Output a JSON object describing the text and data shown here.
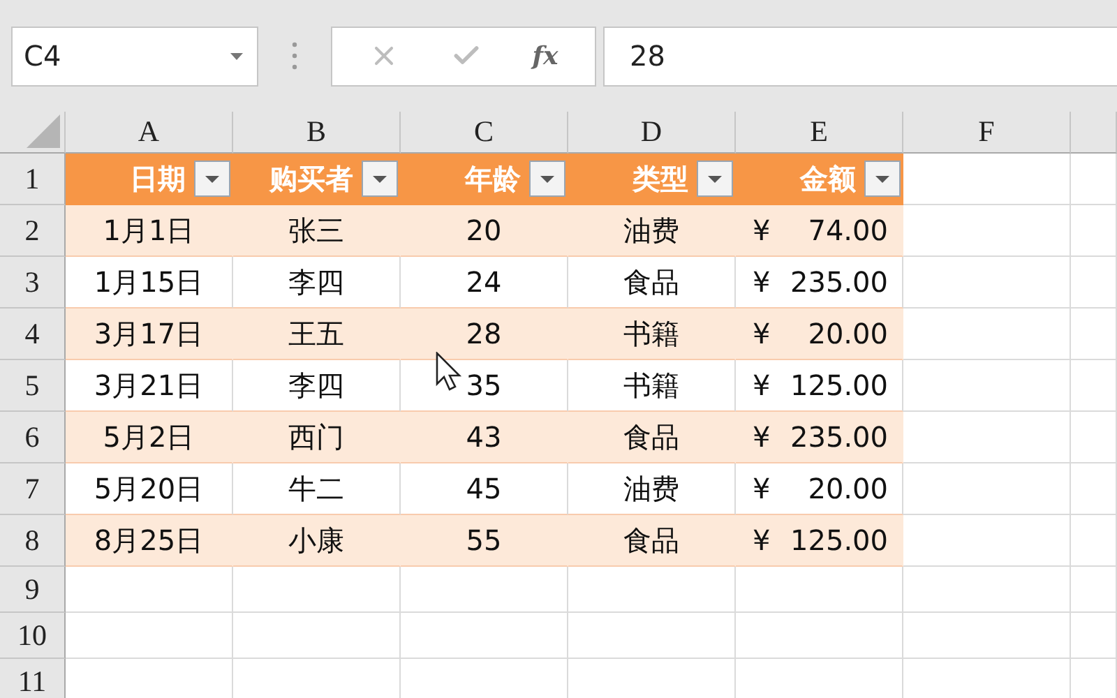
{
  "name_box": {
    "value": "C4"
  },
  "formula_bar": {
    "function_button": "fx",
    "value": "28"
  },
  "columns": [
    "A",
    "B",
    "C",
    "D",
    "E",
    "F"
  ],
  "header": {
    "row_number": "1",
    "cells": [
      "日期",
      "购买者",
      "年龄",
      "类型",
      "金额"
    ]
  },
  "rows": [
    {
      "row_number": "2",
      "date": "1月1日",
      "buyer": "张三",
      "age": "20",
      "type": "油费",
      "currency": "¥",
      "amount": "74.00"
    },
    {
      "row_number": "3",
      "date": "1月15日",
      "buyer": "李四",
      "age": "24",
      "type": "食品",
      "currency": "¥",
      "amount": "235.00"
    },
    {
      "row_number": "4",
      "date": "3月17日",
      "buyer": "王五",
      "age": "28",
      "type": "书籍",
      "currency": "¥",
      "amount": "20.00"
    },
    {
      "row_number": "5",
      "date": "3月21日",
      "buyer": "李四",
      "age": "35",
      "type": "书籍",
      "currency": "¥",
      "amount": "125.00"
    },
    {
      "row_number": "6",
      "date": "5月2日",
      "buyer": "西门",
      "age": "43",
      "type": "食品",
      "currency": "¥",
      "amount": "235.00"
    },
    {
      "row_number": "7",
      "date": "5月20日",
      "buyer": "牛二",
      "age": "45",
      "type": "油费",
      "currency": "¥",
      "amount": "20.00"
    },
    {
      "row_number": "8",
      "date": "8月25日",
      "buyer": "小康",
      "age": "55",
      "type": "食品",
      "currency": "¥",
      "amount": "125.00"
    }
  ],
  "empty_rows": [
    "9",
    "10",
    "11"
  ]
}
